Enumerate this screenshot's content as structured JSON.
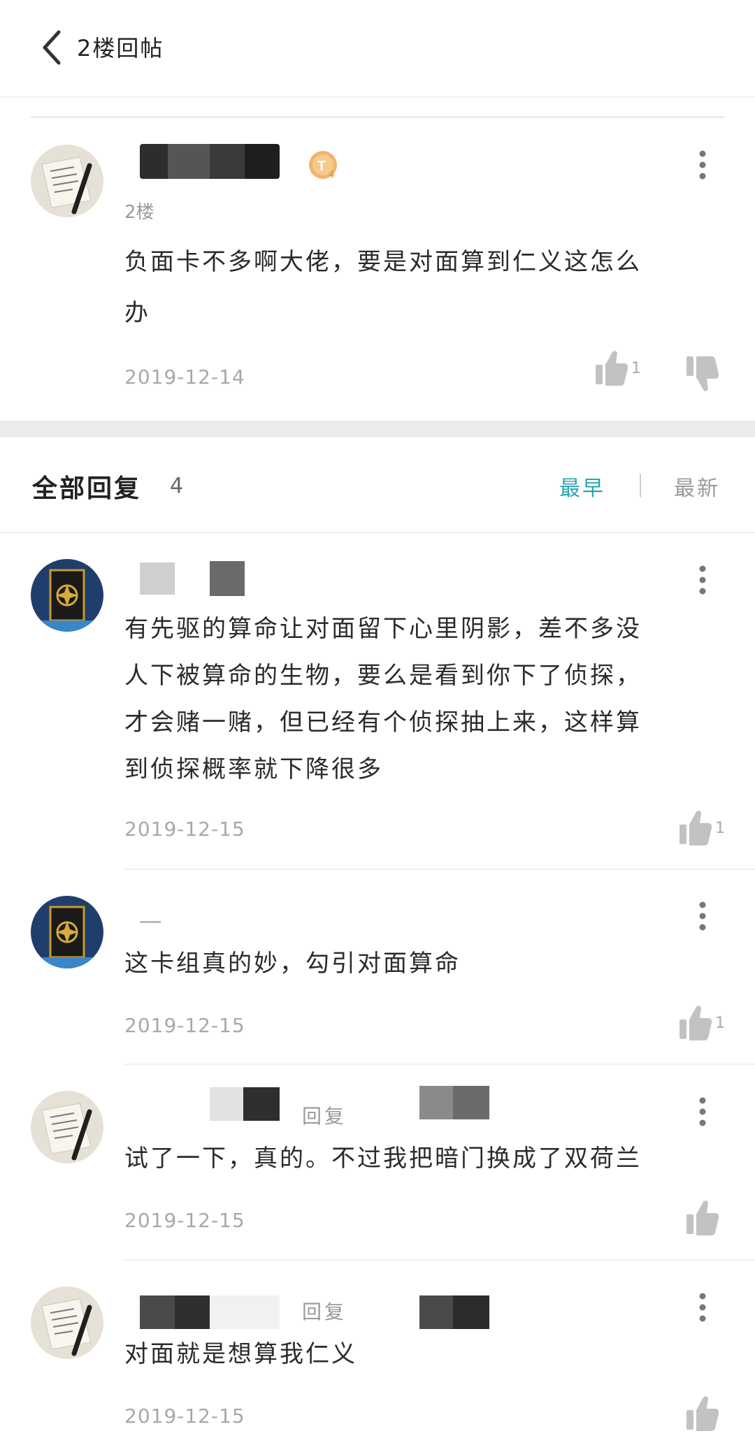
{
  "header": {
    "title": "2楼回帖"
  },
  "main_post": {
    "floor": "2楼",
    "text_line1": "负面卡不多啊大佬，要是对面算到仁义这怎么",
    "text_line2": "办",
    "date": "2019-12-14",
    "likes": "1"
  },
  "replies_section": {
    "title": "全部回复",
    "count": "4",
    "sort_earliest": "最早",
    "sort_latest": "最新"
  },
  "replies": [
    {
      "lines": [
        "有先驱的算命让对面留下心里阴影，差不多没",
        "人下被算命的生物，要么是看到你下了侦探，",
        "才会赌一赌，但已经有个侦探抽上来，这样算",
        "到侦探概率就下降很多"
      ],
      "date": "2019-12-15",
      "likes": "1"
    },
    {
      "lines": [
        "这卡组真的妙，勾引对面算命"
      ],
      "date": "2019-12-15",
      "likes": "1"
    },
    {
      "reply_ref": "回复",
      "lines": [
        "试了一下，真的。不过我把暗门换成了双荷兰"
      ],
      "date": "2019-12-15"
    },
    {
      "reply_ref": "回复",
      "lines": [
        "对面就是想算我仁义"
      ],
      "date": "2019-12-15"
    }
  ],
  "colors": {
    "accent": "#2aa4b4",
    "badge": "#f2b46a",
    "muted": "#a8a8a8"
  }
}
